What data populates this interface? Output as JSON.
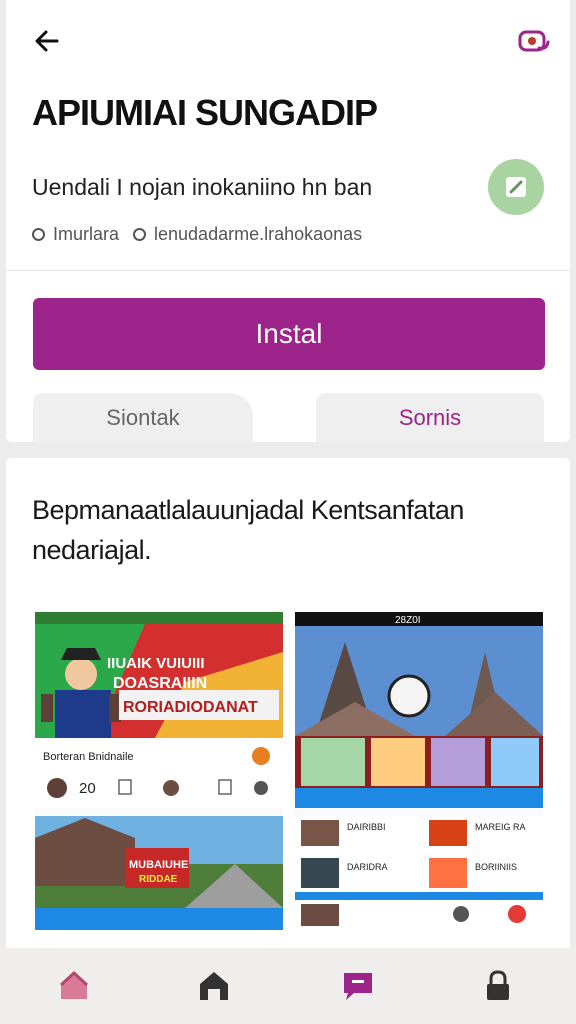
{
  "header": {
    "back_icon": "arrow-left-icon",
    "profile_icon": "profile-switch-icon",
    "app_title": "APIUMIAI SUNGADIP",
    "subtitle": "Uendali I nojan inokaniino hn ban",
    "edit_icon": "edit-icon",
    "meta": [
      "Imurlara",
      "lenudadarme.lrahokaonas"
    ]
  },
  "actions": {
    "install_label": "Instal",
    "tab_left_label": "Siontak",
    "tab_right_label": "Sornis"
  },
  "description": {
    "text": "Bepmanaatlalauunjadal Kentsanfatan nedariajal."
  },
  "screenshots": {
    "left": {
      "banner_lines": [
        "IIUAIK VUIUIII",
        "DOASRAIIIN",
        "RORIADIODANAT"
      ],
      "card_title": "Borteran Bnidnaile",
      "count": "20",
      "tile_banner": [
        "MUBAIUHE",
        "RIDDAE"
      ]
    },
    "right": {
      "status_time": "28Z0I",
      "list_items": [
        "DAIRIBBI",
        "MAREIG RA",
        "DARIDRA",
        "BORIINIIS"
      ]
    }
  },
  "nav": {
    "items": [
      "home-icon",
      "store-icon",
      "chat-icon",
      "lock-icon"
    ]
  },
  "colors": {
    "accent": "#9c248b",
    "fab": "#a9d3a1"
  }
}
